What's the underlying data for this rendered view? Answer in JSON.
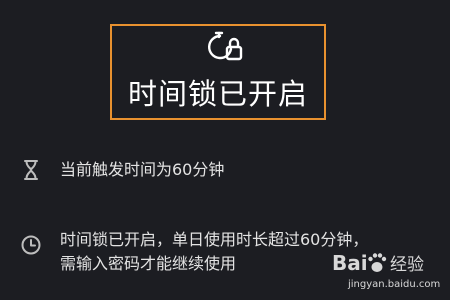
{
  "header": {
    "icon": "timer-lock-icon",
    "title": "时间锁已开启"
  },
  "rows": [
    {
      "icon": "hourglass-icon",
      "text": "当前触发时间为60分钟"
    },
    {
      "icon": "clock-icon",
      "text_line1": "时间锁已开启，单日使用时长超过60分钟，",
      "text_line2": "需输入密码才能继续使用"
    }
  ],
  "watermark": {
    "brand": "Bai 经验",
    "url": "jingyan.baidu.com"
  },
  "colors": {
    "background": "#1c1d22",
    "highlight": "#e8912f",
    "text": "#e3e3e3"
  }
}
